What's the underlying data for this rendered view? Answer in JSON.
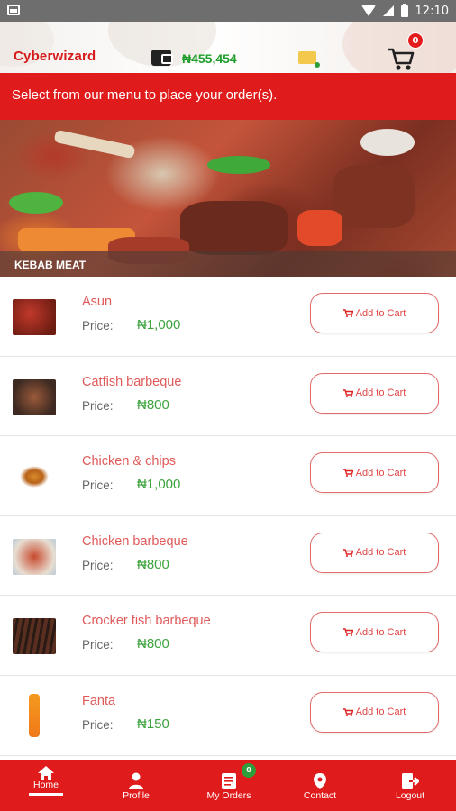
{
  "status_bar": {
    "time": "12:10"
  },
  "header": {
    "brand": "Cyberwizard",
    "balance": "₦455,454",
    "cart_count": "0"
  },
  "notice": "Select from our menu to place your order(s).",
  "hero": {
    "label": "KEBAB MEAT"
  },
  "menu": {
    "price_label": "Price:",
    "add_label": "Add to Cart",
    "items": [
      {
        "name": "Asun",
        "price": "₦1,000"
      },
      {
        "name": "Catfish barbeque",
        "price": "₦800"
      },
      {
        "name": "Chicken & chips",
        "price": "₦1,000"
      },
      {
        "name": "Chicken barbeque",
        "price": "₦800"
      },
      {
        "name": "Crocker fish barbeque",
        "price": "₦800"
      },
      {
        "name": "Fanta",
        "price": "₦150"
      }
    ]
  },
  "bottom_nav": {
    "items": [
      {
        "label": "Home",
        "icon": "home-icon"
      },
      {
        "label": "Profile",
        "icon": "profile-icon"
      },
      {
        "label": "My Orders",
        "icon": "orders-icon"
      },
      {
        "label": "Contact",
        "icon": "contact-icon"
      },
      {
        "label": "Logout",
        "icon": "logout-icon"
      }
    ],
    "orders_badge": "0",
    "active": "Home"
  },
  "colors": {
    "primary_red": "#e01b1b",
    "price_green": "#3ca23c",
    "item_name": "#e05a5a"
  }
}
